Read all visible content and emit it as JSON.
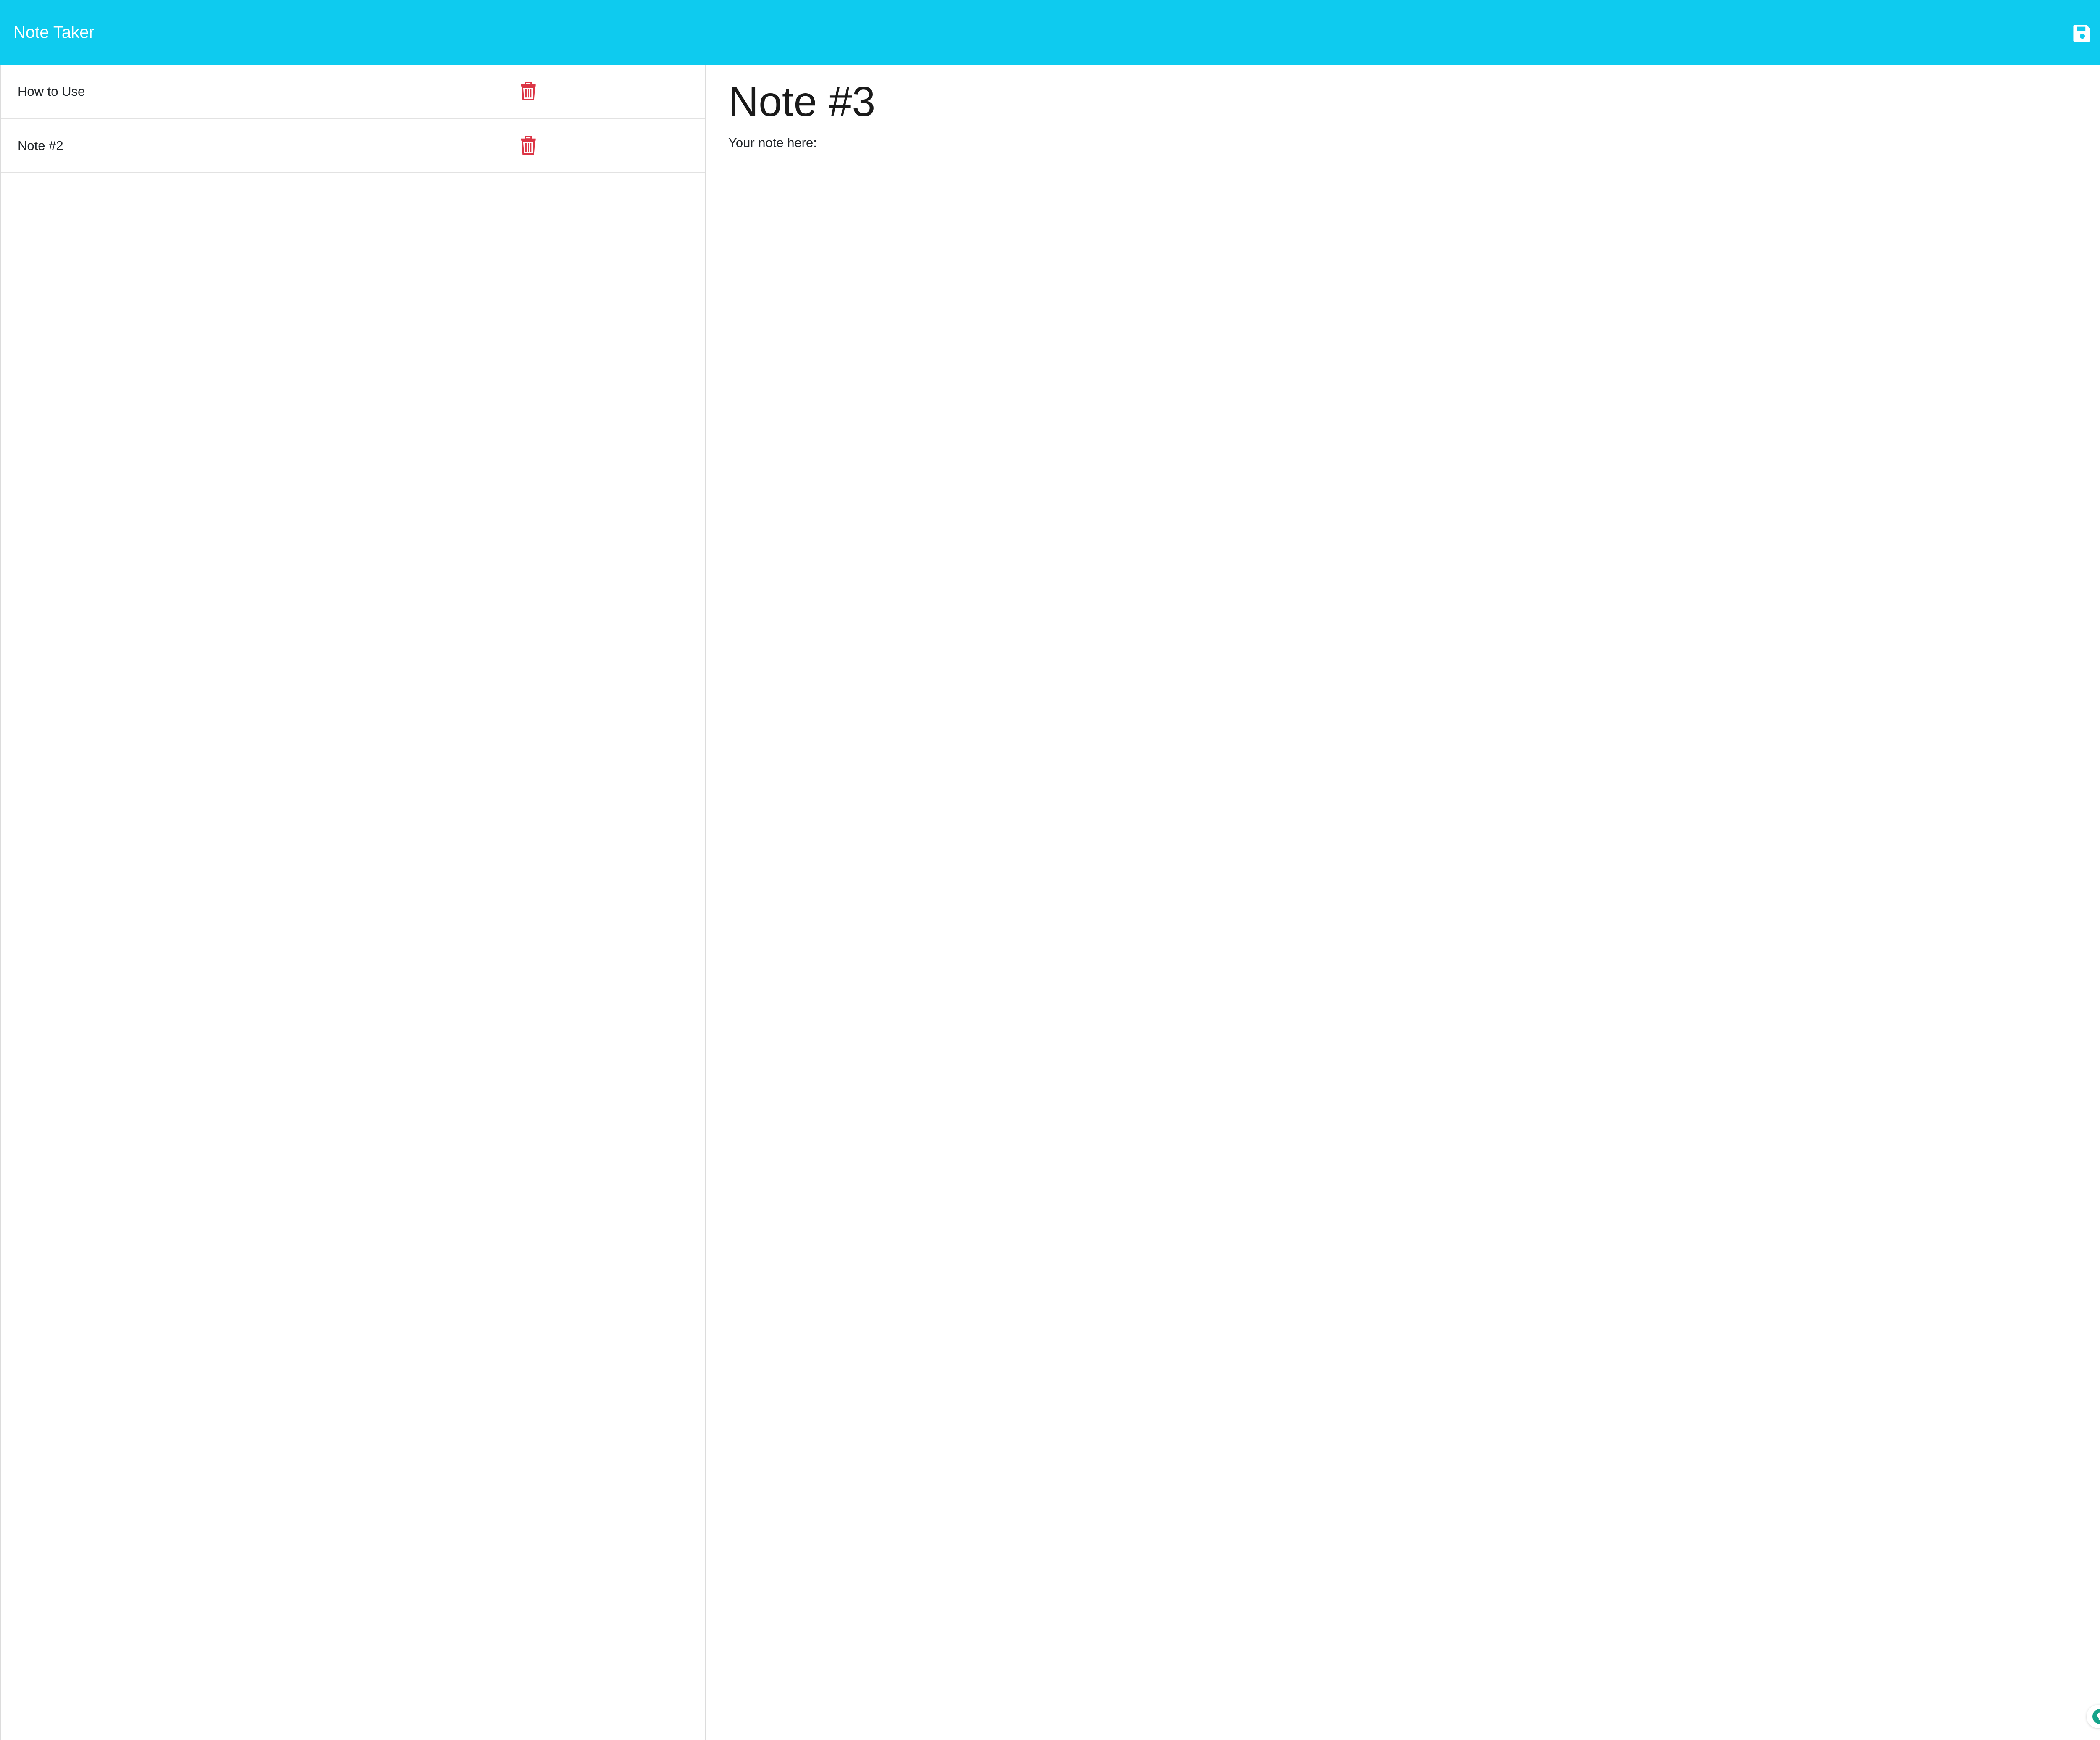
{
  "navbar": {
    "brand": "Note Taker",
    "background_color": "#0ecbef",
    "save_icon": "floppy-disk-icon",
    "new_icon": "plus-icon"
  },
  "sidebar": {
    "notes": [
      {
        "title": "How to Use",
        "delete_icon": "trash-icon"
      },
      {
        "title": "Note #2",
        "delete_icon": "trash-icon"
      }
    ],
    "delete_color": "#dc3545"
  },
  "editor": {
    "title": "Note #3",
    "body": "Your note here:"
  },
  "extension": {
    "icons": [
      "lightbulb-icon",
      "grammarly-icon"
    ],
    "color": "#15a38a"
  }
}
